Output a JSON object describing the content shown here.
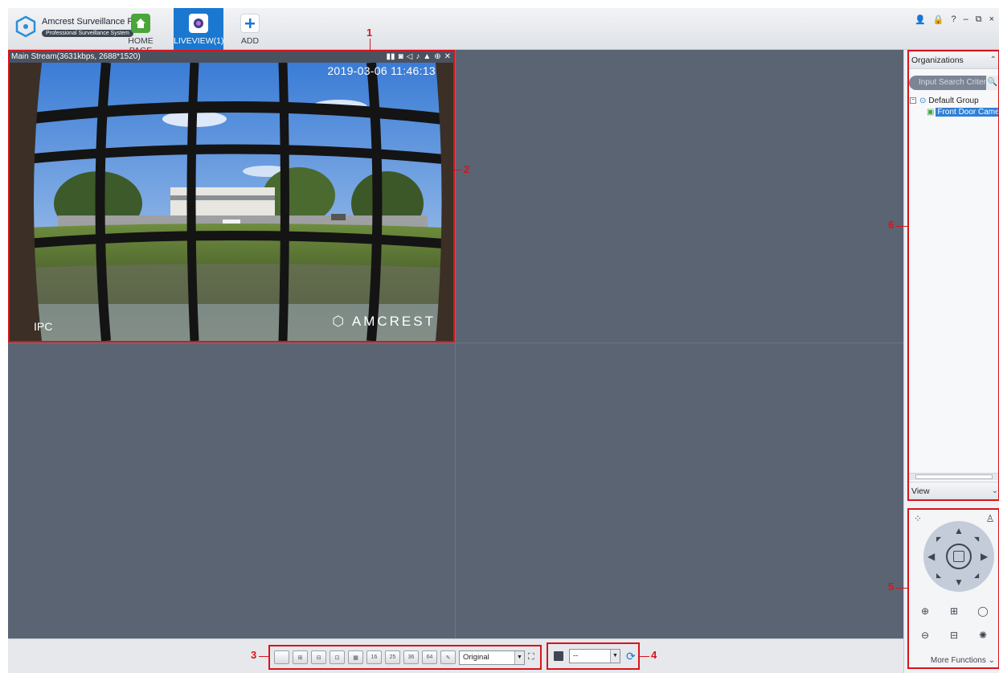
{
  "app": {
    "title": "Amcrest Surveillance Pro",
    "subtitle": "Professional Surveillance System"
  },
  "nav": {
    "tabs": [
      {
        "label": "HOME PAGE",
        "icon": "home-icon",
        "active": false
      },
      {
        "label": "LIVEVIEW(1)",
        "icon": "camera-lens-icon",
        "active": true
      },
      {
        "label": "ADD",
        "icon": "plus-icon",
        "active": false
      }
    ]
  },
  "window_controls": [
    "user-icon",
    "lock-icon",
    "help-icon",
    "minimize-icon",
    "restore-icon",
    "close-icon"
  ],
  "window_control_glyphs": [
    "👤",
    "🔒",
    "?",
    "–",
    "⧉",
    "×"
  ],
  "liveview": {
    "stream_info": "Main Stream(3631kbps, 2688*1520)",
    "timestamp": "2019-03-06 11:46:13",
    "channel_label": "IPC",
    "brand_watermark": "AMCREST"
  },
  "layout_toolbar": {
    "layout_buttons": [
      "1",
      "4",
      "6",
      "8",
      "9",
      "16",
      "25",
      "36",
      "64"
    ],
    "ratio_select": "Original"
  },
  "stream_toolbar": {
    "stream_select": "--"
  },
  "right_panel": {
    "organizations_label": "Organizations",
    "search_placeholder": "Input Search Criteria",
    "tree": {
      "group": "Default Group",
      "device": "Front Door Camera"
    },
    "view_label": "View"
  },
  "ptz": {
    "more_functions": "More Functions"
  },
  "callouts": {
    "c1": "1",
    "c2": "2",
    "c3": "3",
    "c4": "4",
    "c5": "5",
    "c6": "6"
  },
  "colors": {
    "accent": "#1b78d0",
    "highlight_box": "#d8141c",
    "video_bg": "#5a6473"
  }
}
